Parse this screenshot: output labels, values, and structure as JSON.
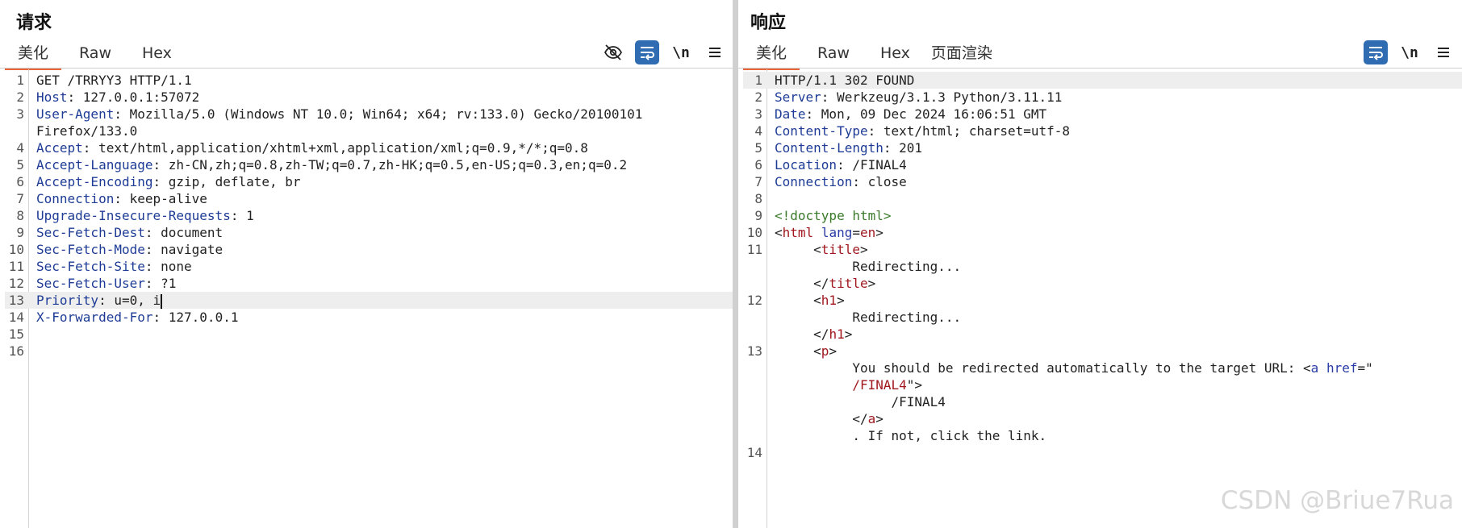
{
  "request": {
    "title": "请求",
    "tabs": [
      "美化",
      "Raw",
      "Hex"
    ],
    "tools": {
      "newline": "\\n"
    }
  },
  "response": {
    "title": "响应",
    "tabs": [
      "美化",
      "Raw",
      "Hex",
      "页面渲染"
    ],
    "tools": {
      "newline": "\\n"
    }
  },
  "watermark": "CSDN @Briue7Rua",
  "request_lines": [
    {
      "n": "1",
      "parts": [
        "GET /TRRYY3 HTTP/1.1"
      ]
    },
    {
      "n": "2",
      "parts": [
        "Host",
        ": 127.0.0.1:57072"
      ]
    },
    {
      "n": "3",
      "parts": [
        "User-Agent",
        ": Mozilla/5.0 (Windows NT 10.0; Win64; x64; rv:133.0) Gecko/20100101"
      ]
    },
    {
      "n": "",
      "parts": [
        "Firefox/133.0"
      ]
    },
    {
      "n": "4",
      "parts": [
        "Accept",
        ": text/html,application/xhtml+xml,application/xml;q=0.9,*/*;q=0.8"
      ]
    },
    {
      "n": "5",
      "parts": [
        "Accept-Language",
        ": zh-CN,zh;q=0.8,zh-TW;q=0.7,zh-HK;q=0.5,en-US;q=0.3,en;q=0.2"
      ]
    },
    {
      "n": "6",
      "parts": [
        "Accept-Encoding",
        ": gzip, deflate, br"
      ]
    },
    {
      "n": "7",
      "parts": [
        "Connection",
        ": keep-alive"
      ]
    },
    {
      "n": "8",
      "parts": [
        "Upgrade-Insecure-Requests",
        ": 1"
      ]
    },
    {
      "n": "9",
      "parts": [
        "Sec-Fetch-Dest",
        ": document"
      ]
    },
    {
      "n": "10",
      "parts": [
        "Sec-Fetch-Mode",
        ": navigate"
      ]
    },
    {
      "n": "11",
      "parts": [
        "Sec-Fetch-Site",
        ": none"
      ]
    },
    {
      "n": "12",
      "parts": [
        "Sec-Fetch-User",
        ": ?1"
      ]
    },
    {
      "n": "13",
      "parts": [
        "Priority",
        ": u=0, i"
      ]
    },
    {
      "n": "14",
      "parts": [
        "X-Forwarded-For",
        ": 127.0.0.1"
      ]
    },
    {
      "n": "15",
      "parts": [
        ""
      ]
    },
    {
      "n": "16",
      "parts": [
        ""
      ]
    }
  ],
  "response_lines": [
    {
      "n": "1",
      "parts": [
        "HTTP/1.1 302 FOUND"
      ]
    },
    {
      "n": "2",
      "parts": [
        "Server",
        ": Werkzeug/3.1.3 Python/3.11.11"
      ]
    },
    {
      "n": "3",
      "parts": [
        "Date",
        ": Mon, 09 Dec 2024 16:06:51 GMT"
      ]
    },
    {
      "n": "4",
      "parts": [
        "Content-Type",
        ": text/html; charset=utf-8"
      ]
    },
    {
      "n": "5",
      "parts": [
        "Content-Length",
        ": 201"
      ]
    },
    {
      "n": "6",
      "parts": [
        "Location",
        ": /FINAL4"
      ]
    },
    {
      "n": "7",
      "parts": [
        "Connection",
        ": close"
      ]
    },
    {
      "n": "8",
      "parts": [
        ""
      ]
    },
    {
      "n": "9",
      "parts": [
        "<!doctype html>"
      ]
    },
    {
      "n": "10",
      "parts": [
        "<",
        "html",
        " ",
        "lang",
        "=",
        "en",
        ">"
      ]
    },
    {
      "n": "11",
      "parts": [
        "     <",
        "title",
        ">"
      ]
    },
    {
      "n": "",
      "parts": [
        "          Redirecting..."
      ]
    },
    {
      "n": "",
      "parts": [
        "     </",
        "title",
        ">"
      ]
    },
    {
      "n": "12",
      "parts": [
        "     <",
        "h1",
        ">"
      ]
    },
    {
      "n": "",
      "parts": [
        "          Redirecting..."
      ]
    },
    {
      "n": "",
      "parts": [
        "     </",
        "h1",
        ">"
      ]
    },
    {
      "n": "13",
      "parts": [
        "     <",
        "p",
        ">"
      ]
    },
    {
      "n": "",
      "parts": [
        "          You should be redirected automatically to the target URL: <",
        "a",
        " ",
        "href",
        "=\""
      ]
    },
    {
      "n": "",
      "parts": [
        "          ",
        "/FINAL4",
        "\">"
      ]
    },
    {
      "n": "",
      "parts": [
        "               /FINAL4"
      ]
    },
    {
      "n": "",
      "parts": [
        "          </",
        "a",
        ">"
      ]
    },
    {
      "n": "",
      "parts": [
        "          . If not, click the link."
      ]
    },
    {
      "n": "14",
      "parts": [
        ""
      ]
    }
  ],
  "colors": {
    "accent_tab": "#e8653a",
    "toggle_on": "#2f6cb1",
    "header_key": "#1e3c96",
    "tag": "#a0181e"
  }
}
